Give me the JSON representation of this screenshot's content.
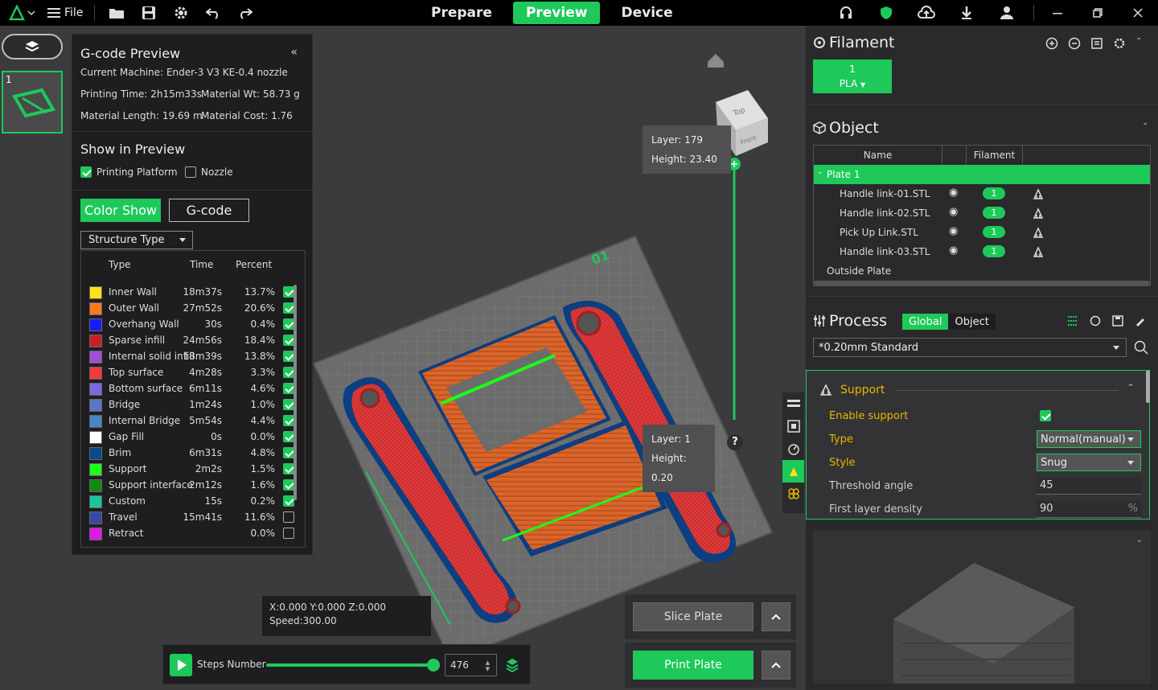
{
  "topbar": {
    "file_label": "File",
    "tabs": [
      {
        "label": "Prepare",
        "active": false
      },
      {
        "label": "Preview",
        "active": true
      },
      {
        "label": "Device",
        "active": false
      }
    ]
  },
  "plate_thumb": {
    "number": "1"
  },
  "gcode_preview": {
    "title": "G-code Preview",
    "machine": "Current Machine: Ender-3 V3 KE-0.4 nozzle",
    "printing_time": "Printing Time: 2h15m33s",
    "material_wt": "Material Wt: 58.73 g",
    "material_length": "Material Length: 19.69 m",
    "material_cost": "Material Cost: 1.76",
    "show_title": "Show in Preview",
    "printing_platform": "Printing Platform",
    "nozzle": "Nozzle",
    "color_show": "Color Show",
    "gcode": "G-code",
    "structure_type": "Structure Type",
    "headers": {
      "type": "Type",
      "time": "Time",
      "percent": "Percent"
    },
    "rows": [
      {
        "color": "#ffe21a",
        "type": "Inner Wall",
        "time": "18m37s",
        "pct": "13.7%",
        "checked": true
      },
      {
        "color": "#ff7a1f",
        "type": "Outer Wall",
        "time": "27m52s",
        "pct": "20.6%",
        "checked": true
      },
      {
        "color": "#1a1aff",
        "type": "Overhang Wall",
        "time": "30s",
        "pct": "0.4%",
        "checked": true
      },
      {
        "color": "#c8202a",
        "type": "Sparse infill",
        "time": "24m56s",
        "pct": "18.4%",
        "checked": true
      },
      {
        "color": "#a44fd6",
        "type": "Internal solid infill",
        "time": "18m39s",
        "pct": "13.8%",
        "checked": true
      },
      {
        "color": "#f03a40",
        "type": "Top surface",
        "time": "4m28s",
        "pct": "3.3%",
        "checked": true
      },
      {
        "color": "#7a6ae0",
        "type": "Bottom surface",
        "time": "6m11s",
        "pct": "4.6%",
        "checked": true
      },
      {
        "color": "#5a78c8",
        "type": "Bridge",
        "time": "1m24s",
        "pct": "1.0%",
        "checked": true
      },
      {
        "color": "#4a84c4",
        "type": "Internal Bridge",
        "time": "5m54s",
        "pct": "4.4%",
        "checked": true
      },
      {
        "color": "#ffffff",
        "type": "Gap Fill",
        "time": "0s",
        "pct": "0.0%",
        "checked": true
      },
      {
        "color": "#0a4a8a",
        "type": "Brim",
        "time": "6m31s",
        "pct": "4.8%",
        "checked": true
      },
      {
        "color": "#1aff1a",
        "type": "Support",
        "time": "2m2s",
        "pct": "1.5%",
        "checked": true
      },
      {
        "color": "#128a12",
        "type": "Support interface",
        "time": "2m12s",
        "pct": "1.6%",
        "checked": true
      },
      {
        "color": "#16c8a0",
        "type": "Custom",
        "time": "15s",
        "pct": "0.2%",
        "checked": true
      },
      {
        "color": "#3a46a8",
        "type": "Travel",
        "time": "15m41s",
        "pct": "11.6%",
        "checked": false
      },
      {
        "color": "#e01ae0",
        "type": "Retract",
        "time": "",
        "pct": "0.0%",
        "checked": false
      }
    ]
  },
  "viewport": {
    "plate_number": "01",
    "layer_top": {
      "layer": "Layer: 179",
      "height": "Height: 23.40"
    },
    "layer_bottom": {
      "layer": "Layer: 1",
      "height": "Height: 0.20"
    },
    "coords": "X:0.000  Y:0.000  Z:0.000",
    "speed": "Speed:300.00",
    "steps_label": "Steps Number",
    "steps_value": "476",
    "slice_plate": "Slice Plate",
    "print_plate": "Print Plate",
    "help": "?",
    "cube_top": "Top",
    "cube_front": "Front"
  },
  "filament": {
    "title": "Filament",
    "slot_number": "1",
    "slot_type": "PLA"
  },
  "object": {
    "title": "Object",
    "col_name": "Name",
    "col_filament": "Filament",
    "plate": "Plate 1",
    "items": [
      {
        "name": "Handle link-01.STL",
        "filament": "1"
      },
      {
        "name": "Handle link-02.STL",
        "filament": "1"
      },
      {
        "name": "Pick Up Link.STL",
        "filament": "1"
      },
      {
        "name": "Handle link-03.STL",
        "filament": "1"
      }
    ],
    "outside": "Outside Plate"
  },
  "process": {
    "title": "Process",
    "seg_global": "Global",
    "seg_object": "Object",
    "preset": "*0.20mm Standard",
    "support_title": "Support",
    "enable_support": "Enable support",
    "type_label": "Type",
    "type_value": "Normal(manual)",
    "style_label": "Style",
    "style_value": "Snug",
    "threshold_label": "Threshold angle",
    "threshold_value": "45",
    "density_label": "First layer density",
    "density_value": "90",
    "density_unit": "%"
  }
}
